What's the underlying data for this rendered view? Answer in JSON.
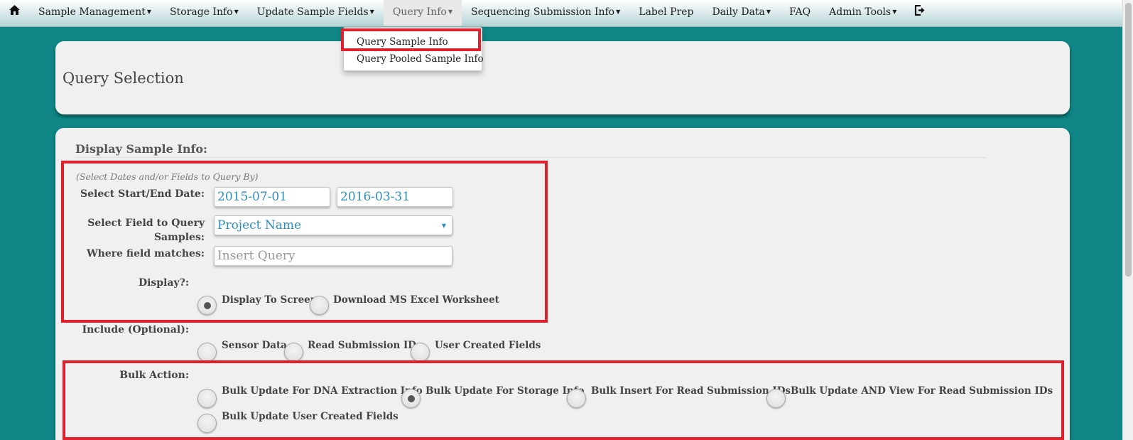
{
  "nav": {
    "items": [
      {
        "label": "Sample Management",
        "caret": true
      },
      {
        "label": "Storage Info",
        "caret": true
      },
      {
        "label": "Update Sample Fields",
        "caret": true
      },
      {
        "label": "Query Info",
        "caret": true
      },
      {
        "label": "Sequencing Submission Info",
        "caret": true
      },
      {
        "label": "Label Prep",
        "caret": false
      },
      {
        "label": "Daily Data",
        "caret": true
      },
      {
        "label": "FAQ",
        "caret": false
      },
      {
        "label": "Admin Tools",
        "caret": true
      }
    ],
    "active": "Query Info",
    "home_icon": "home-icon",
    "logout_icon": "logout-icon"
  },
  "dropdown": {
    "items": [
      "Query Sample Info",
      "Query Pooled Sample Info"
    ]
  },
  "page": {
    "title": "Query Selection"
  },
  "form": {
    "section_title": "Display Sample Info:",
    "hint": "(Select Dates and/or Fields to Query By)",
    "date_label": "Select Start/End Date:",
    "start_date": "2015-07-01",
    "end_date": "2016-03-31",
    "field_label_line1": "Select Field to Query",
    "field_label_line2": "Samples:",
    "field_selected": "Project Name",
    "match_label": "Where field matches:",
    "match_placeholder": "Insert Query",
    "display_label": "Display?:",
    "display_options": [
      "Display To Screen",
      "Download MS Excel Worksheet"
    ],
    "display_checked": "Display To Screen",
    "include_label": "Include (Optional):",
    "include_options": [
      "Sensor Data",
      "Read Submission IDs",
      "User Created Fields"
    ],
    "bulk_label": "Bulk Action:",
    "bulk_options": [
      "Bulk Update For DNA Extraction Info",
      "Bulk Update For Storage Info",
      "Bulk Insert For Read Submission IDs",
      "Bulk Update AND View For Read Submission IDs",
      "Bulk Update User Created Fields"
    ],
    "bulk_checked": "Bulk Update For Storage Info"
  },
  "colors": {
    "background": "#0f8585",
    "highlight": "#e0202c",
    "value_text": "#2a8fbe"
  }
}
